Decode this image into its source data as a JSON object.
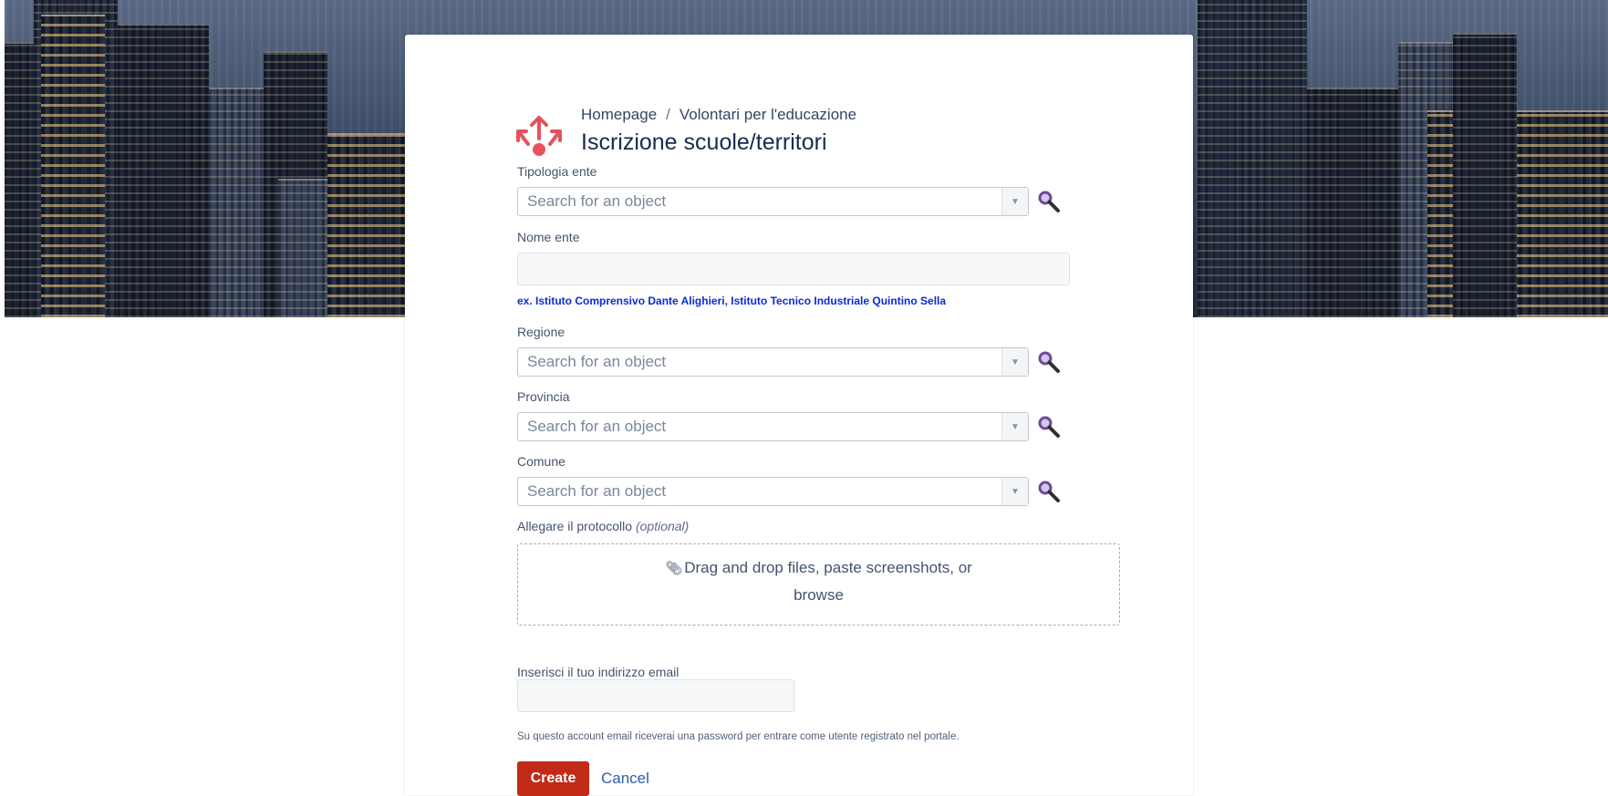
{
  "breadcrumb": {
    "home": "Homepage",
    "separator": "/",
    "section": "Volontari per l'educazione"
  },
  "page_title": "Iscrizione scuole/territori",
  "form": {
    "tipologia": {
      "label": "Tipologia ente",
      "placeholder": "Search for an object"
    },
    "nome": {
      "label": "Nome ente",
      "value": "",
      "hint": "ex. Istituto Comprensivo Dante Alighieri, Istituto Tecnico Industriale Quintino Sella"
    },
    "regione": {
      "label": "Regione",
      "placeholder": "Search for an object"
    },
    "provincia": {
      "label": "Provincia",
      "placeholder": "Search for an object"
    },
    "comune": {
      "label": "Comune",
      "placeholder": "Search for an object"
    },
    "allegato": {
      "label": "Allegare il protocollo",
      "optional": "(optional)",
      "drop_text": "Drag and drop files, paste screenshots, or",
      "browse": "browse"
    },
    "email": {
      "label": "Inserisci il tuo indirizzo email",
      "value": "",
      "hint": "Su questo account email riceverai una password per entrare come utente registrato nel portale."
    }
  },
  "actions": {
    "create": "Create",
    "cancel": "Cancel"
  },
  "colors": {
    "create_button": "#c12a16",
    "hint_text": "#0b2bd4",
    "logo": "#e5525f",
    "search_icon": "#6e4a99"
  },
  "icons": {
    "logo": "request-type-icon",
    "search": "magnifier-icon",
    "attach": "paperclip-icon",
    "dropdown": "triangle-down-icon"
  }
}
